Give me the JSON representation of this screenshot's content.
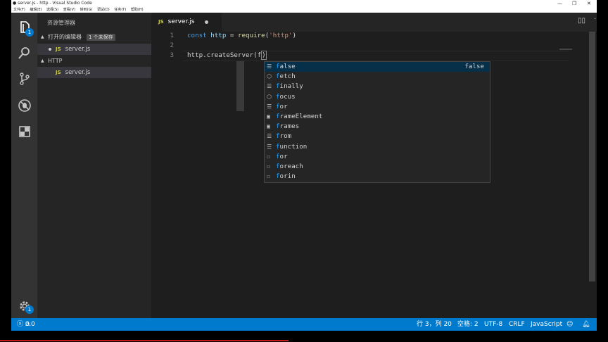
{
  "window": {
    "title": "● server.js - http - Visual Studio Code",
    "controls": [
      "—",
      "❐",
      "✕"
    ]
  },
  "menu": [
    "文件(F)",
    "编辑(E)",
    "选择(S)",
    "查看(V)",
    "转到(G)",
    "调试(D)",
    "任务(T)",
    "帮助(H)"
  ],
  "activity": {
    "explorer_badge": "1",
    "settings_badge": "1"
  },
  "sidebar": {
    "title": "资源管理器",
    "open_editors": {
      "label": "打开的编辑器",
      "badge": "1 个未保存"
    },
    "open_files": [
      {
        "icon": "JS",
        "name": "server.js"
      }
    ],
    "folder": {
      "label": "HTTP",
      "files": [
        {
          "icon": "JS",
          "name": "server.js"
        }
      ]
    }
  },
  "tab": {
    "icon": "JS",
    "label": "server.js"
  },
  "editor": {
    "line_numbers": [
      "1",
      "2",
      "3"
    ],
    "line1": {
      "kw": "const",
      "sp1": " ",
      "var": "http",
      "eq": " = ",
      "fn": "require",
      "p1": "(",
      "str": "'http'",
      "p2": ")"
    },
    "line3": {
      "text1": "http.createServer(",
      "text2": "f",
      "text3": ")"
    }
  },
  "suggestions": [
    {
      "icon": "keyword",
      "match": "f",
      "rest": "alse",
      "detail": "false"
    },
    {
      "icon": "module",
      "match": "f",
      "rest": "etch",
      "detail": ""
    },
    {
      "icon": "keyword",
      "match": "f",
      "rest": "inally",
      "detail": ""
    },
    {
      "icon": "module",
      "match": "f",
      "rest": "ocus",
      "detail": ""
    },
    {
      "icon": "keyword",
      "match": "f",
      "rest": "or",
      "detail": ""
    },
    {
      "icon": "variable",
      "match": "f",
      "rest": "rameElement",
      "detail": ""
    },
    {
      "icon": "variable",
      "match": "f",
      "rest": "rames",
      "detail": ""
    },
    {
      "icon": "keyword",
      "match": "f",
      "rest": "rom",
      "detail": ""
    },
    {
      "icon": "keyword",
      "match": "f",
      "rest": "unction",
      "detail": ""
    },
    {
      "icon": "snippet",
      "match": "f",
      "rest": "or",
      "detail": ""
    },
    {
      "icon": "snippet",
      "match": "f",
      "rest": "oreach",
      "detail": ""
    },
    {
      "icon": "snippet",
      "match": "f",
      "rest": "orin",
      "detail": ""
    }
  ],
  "status": {
    "errors": "0",
    "warnings": "0",
    "position": "行 3，列 20",
    "spaces": "空格: 2",
    "encoding": "UTF-8",
    "eol": "CRLF",
    "language": "JavaScript"
  },
  "colors": {
    "accent": "#007acc",
    "match": "#18a3ff",
    "selection": "#062f4a"
  }
}
